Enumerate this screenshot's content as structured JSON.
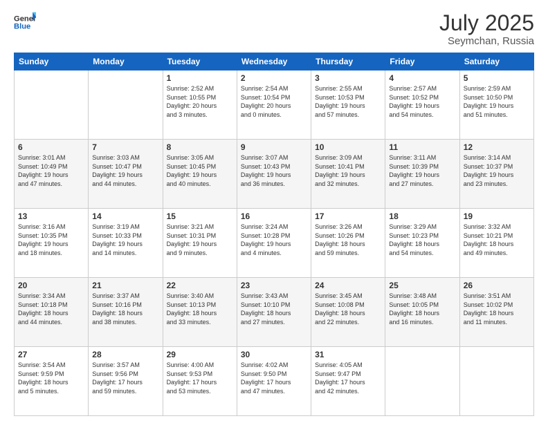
{
  "header": {
    "logo_line1": "General",
    "logo_line2": "Blue",
    "month": "July 2025",
    "location": "Seymchan, Russia"
  },
  "weekdays": [
    "Sunday",
    "Monday",
    "Tuesday",
    "Wednesday",
    "Thursday",
    "Friday",
    "Saturday"
  ],
  "weeks": [
    [
      {
        "day": "",
        "info": ""
      },
      {
        "day": "",
        "info": ""
      },
      {
        "day": "1",
        "info": "Sunrise: 2:52 AM\nSunset: 10:55 PM\nDaylight: 20 hours\nand 3 minutes."
      },
      {
        "day": "2",
        "info": "Sunrise: 2:54 AM\nSunset: 10:54 PM\nDaylight: 20 hours\nand 0 minutes."
      },
      {
        "day": "3",
        "info": "Sunrise: 2:55 AM\nSunset: 10:53 PM\nDaylight: 19 hours\nand 57 minutes."
      },
      {
        "day": "4",
        "info": "Sunrise: 2:57 AM\nSunset: 10:52 PM\nDaylight: 19 hours\nand 54 minutes."
      },
      {
        "day": "5",
        "info": "Sunrise: 2:59 AM\nSunset: 10:50 PM\nDaylight: 19 hours\nand 51 minutes."
      }
    ],
    [
      {
        "day": "6",
        "info": "Sunrise: 3:01 AM\nSunset: 10:49 PM\nDaylight: 19 hours\nand 47 minutes."
      },
      {
        "day": "7",
        "info": "Sunrise: 3:03 AM\nSunset: 10:47 PM\nDaylight: 19 hours\nand 44 minutes."
      },
      {
        "day": "8",
        "info": "Sunrise: 3:05 AM\nSunset: 10:45 PM\nDaylight: 19 hours\nand 40 minutes."
      },
      {
        "day": "9",
        "info": "Sunrise: 3:07 AM\nSunset: 10:43 PM\nDaylight: 19 hours\nand 36 minutes."
      },
      {
        "day": "10",
        "info": "Sunrise: 3:09 AM\nSunset: 10:41 PM\nDaylight: 19 hours\nand 32 minutes."
      },
      {
        "day": "11",
        "info": "Sunrise: 3:11 AM\nSunset: 10:39 PM\nDaylight: 19 hours\nand 27 minutes."
      },
      {
        "day": "12",
        "info": "Sunrise: 3:14 AM\nSunset: 10:37 PM\nDaylight: 19 hours\nand 23 minutes."
      }
    ],
    [
      {
        "day": "13",
        "info": "Sunrise: 3:16 AM\nSunset: 10:35 PM\nDaylight: 19 hours\nand 18 minutes."
      },
      {
        "day": "14",
        "info": "Sunrise: 3:19 AM\nSunset: 10:33 PM\nDaylight: 19 hours\nand 14 minutes."
      },
      {
        "day": "15",
        "info": "Sunrise: 3:21 AM\nSunset: 10:31 PM\nDaylight: 19 hours\nand 9 minutes."
      },
      {
        "day": "16",
        "info": "Sunrise: 3:24 AM\nSunset: 10:28 PM\nDaylight: 19 hours\nand 4 minutes."
      },
      {
        "day": "17",
        "info": "Sunrise: 3:26 AM\nSunset: 10:26 PM\nDaylight: 18 hours\nand 59 minutes."
      },
      {
        "day": "18",
        "info": "Sunrise: 3:29 AM\nSunset: 10:23 PM\nDaylight: 18 hours\nand 54 minutes."
      },
      {
        "day": "19",
        "info": "Sunrise: 3:32 AM\nSunset: 10:21 PM\nDaylight: 18 hours\nand 49 minutes."
      }
    ],
    [
      {
        "day": "20",
        "info": "Sunrise: 3:34 AM\nSunset: 10:18 PM\nDaylight: 18 hours\nand 44 minutes."
      },
      {
        "day": "21",
        "info": "Sunrise: 3:37 AM\nSunset: 10:16 PM\nDaylight: 18 hours\nand 38 minutes."
      },
      {
        "day": "22",
        "info": "Sunrise: 3:40 AM\nSunset: 10:13 PM\nDaylight: 18 hours\nand 33 minutes."
      },
      {
        "day": "23",
        "info": "Sunrise: 3:43 AM\nSunset: 10:10 PM\nDaylight: 18 hours\nand 27 minutes."
      },
      {
        "day": "24",
        "info": "Sunrise: 3:45 AM\nSunset: 10:08 PM\nDaylight: 18 hours\nand 22 minutes."
      },
      {
        "day": "25",
        "info": "Sunrise: 3:48 AM\nSunset: 10:05 PM\nDaylight: 18 hours\nand 16 minutes."
      },
      {
        "day": "26",
        "info": "Sunrise: 3:51 AM\nSunset: 10:02 PM\nDaylight: 18 hours\nand 11 minutes."
      }
    ],
    [
      {
        "day": "27",
        "info": "Sunrise: 3:54 AM\nSunset: 9:59 PM\nDaylight: 18 hours\nand 5 minutes."
      },
      {
        "day": "28",
        "info": "Sunrise: 3:57 AM\nSunset: 9:56 PM\nDaylight: 17 hours\nand 59 minutes."
      },
      {
        "day": "29",
        "info": "Sunrise: 4:00 AM\nSunset: 9:53 PM\nDaylight: 17 hours\nand 53 minutes."
      },
      {
        "day": "30",
        "info": "Sunrise: 4:02 AM\nSunset: 9:50 PM\nDaylight: 17 hours\nand 47 minutes."
      },
      {
        "day": "31",
        "info": "Sunrise: 4:05 AM\nSunset: 9:47 PM\nDaylight: 17 hours\nand 42 minutes."
      },
      {
        "day": "",
        "info": ""
      },
      {
        "day": "",
        "info": ""
      }
    ]
  ]
}
